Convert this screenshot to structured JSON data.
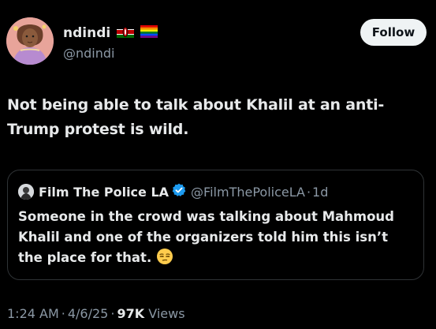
{
  "author": {
    "display_name": "ndindi",
    "handle": "@ndindi",
    "badges": [
      "kenya-flag-icon",
      "rainbow-flag-icon"
    ]
  },
  "actions": {
    "follow_label": "Follow"
  },
  "tweet": {
    "text": "Not being able to talk about Khalil at an anti-Trump protest is wild."
  },
  "quote": {
    "display_name": "Film The Police LA",
    "verified": true,
    "handle": "@FilmThePoliceLA",
    "separator": "·",
    "time": "1d",
    "text": "Someone in the crowd was talking about Mahmoud Khalil and one of the organizers told him this isn’t the place for that.",
    "emoji": "unamused-face-icon"
  },
  "meta": {
    "time": "1:24 AM",
    "date": "4/6/25",
    "separator": "·",
    "views_count": "97K",
    "views_label": "Views"
  },
  "colors": {
    "background": "#000000",
    "primary_text": "#e7e9ea",
    "secondary_text": "#8b98a5",
    "border": "#2f3336",
    "follow_button_bg": "#eff3f4",
    "verified_blue": "#1d9bf0"
  }
}
